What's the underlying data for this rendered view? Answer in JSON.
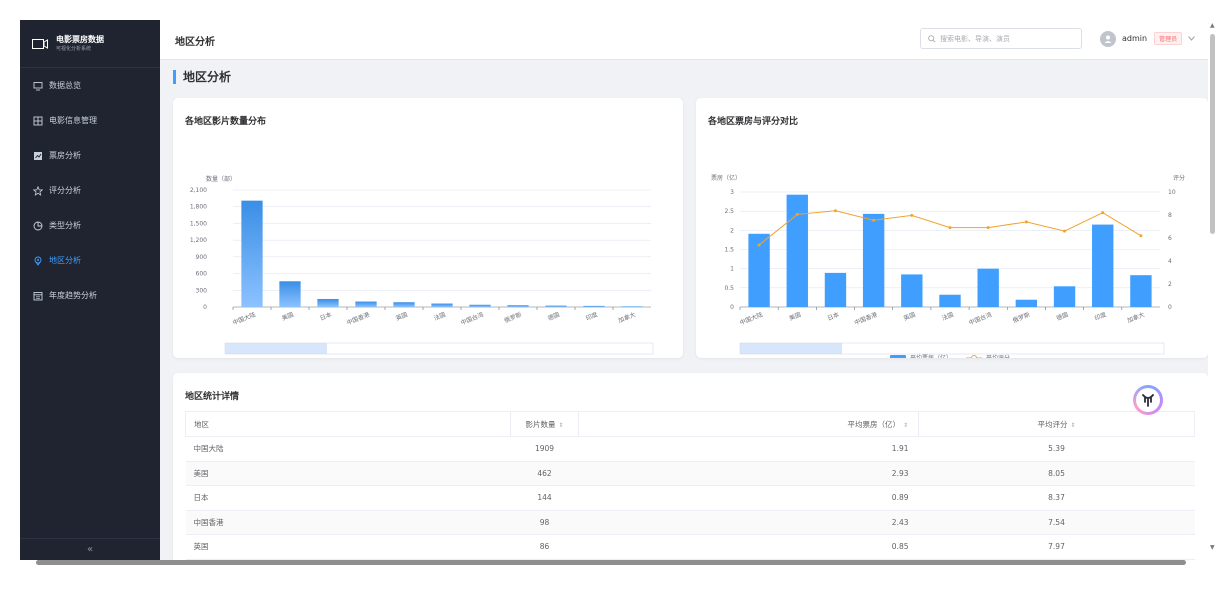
{
  "brand": {
    "title": "电影票房数据",
    "subtitle": "可视化分析系统"
  },
  "menu": [
    {
      "label": "数据总览",
      "icon": "monitor-icon",
      "active": false
    },
    {
      "label": "电影信息管理",
      "icon": "film-grid-icon",
      "active": false
    },
    {
      "label": "票房分析",
      "icon": "chart-icon",
      "active": false
    },
    {
      "label": "评分分析",
      "icon": "star-icon",
      "active": false
    },
    {
      "label": "类型分析",
      "icon": "pie-icon",
      "active": false
    },
    {
      "label": "地区分析",
      "icon": "location-icon",
      "active": true
    },
    {
      "label": "年度趋势分析",
      "icon": "calendar-icon",
      "active": false
    }
  ],
  "collapse_label": "«",
  "header": {
    "title": "地区分析",
    "search_placeholder": "搜索电影、导演、演员",
    "username": "admin",
    "role": "管理员"
  },
  "page_title": "地区分析",
  "chart_data": [
    {
      "type": "bar",
      "title": "各地区影片数量分布",
      "ylabel": "数量（部）",
      "categories": [
        "中国大陆",
        "美国",
        "日本",
        "中国香港",
        "英国",
        "法国",
        "中国台湾",
        "俄罗斯",
        "德国",
        "印度",
        "加拿大"
      ],
      "values": [
        1909,
        462,
        144,
        98,
        86,
        62,
        40,
        32,
        25,
        20,
        12
      ],
      "ylim": [
        0,
        2100
      ],
      "yticks": [
        "0",
        "300",
        "600",
        "900",
        "1,200",
        "1,500",
        "1,800",
        "2,100"
      ],
      "grid": true,
      "color": "#409eff"
    },
    {
      "type": "bar",
      "title": "各地区票房与评分对比",
      "ylabel": "票房（亿）",
      "y2label": "评分",
      "categories": [
        "中国大陆",
        "美国",
        "日本",
        "中国香港",
        "英国",
        "法国",
        "中国台湾",
        "俄罗斯",
        "德国",
        "印度",
        "加拿大"
      ],
      "series": [
        {
          "name": "平均票房（亿）",
          "kind": "bar",
          "values": [
            1.91,
            2.93,
            0.89,
            2.43,
            0.85,
            0.32,
            1.0,
            0.19,
            0.54,
            2.15,
            0.83
          ],
          "color": "#409eff"
        },
        {
          "name": "平均评分",
          "kind": "line",
          "values": [
            5.39,
            8.05,
            8.37,
            7.54,
            7.97,
            6.9,
            6.9,
            7.4,
            6.6,
            8.2,
            6.2
          ],
          "color": "#f0a332"
        }
      ],
      "ylim": [
        0,
        3
      ],
      "yticks": [
        "0",
        "0.5",
        "1",
        "1.5",
        "2",
        "2.5",
        "3"
      ],
      "y2lim": [
        0,
        10
      ],
      "y2ticks": [
        "0",
        "2",
        "4",
        "6",
        "8",
        "10"
      ],
      "legend": "bottom",
      "grid": true
    }
  ],
  "table": {
    "title": "地区统计详情",
    "columns": [
      "地区",
      "影片数量",
      "平均票房（亿）",
      "平均评分"
    ],
    "sort_icon": "⇕",
    "rows": [
      [
        "中国大陆",
        "1909",
        "1.91",
        "5.39"
      ],
      [
        "美国",
        "462",
        "2.93",
        "8.05"
      ],
      [
        "日本",
        "144",
        "0.89",
        "8.37"
      ],
      [
        "中国香港",
        "98",
        "2.43",
        "7.54"
      ],
      [
        "英国",
        "86",
        "0.85",
        "7.97"
      ]
    ]
  }
}
